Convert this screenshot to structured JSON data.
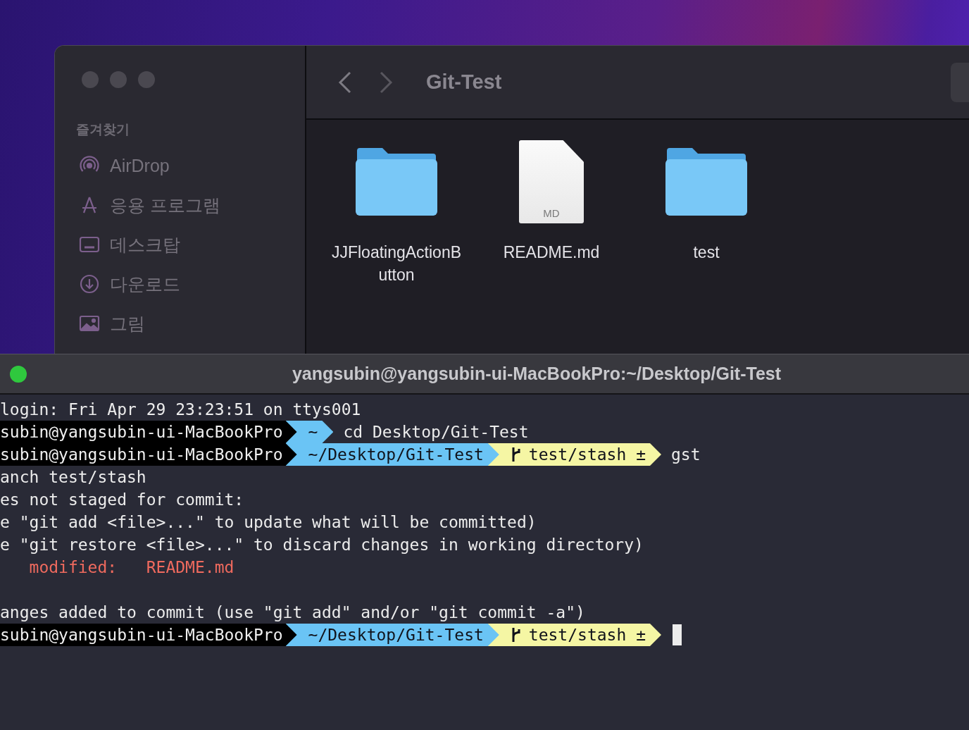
{
  "finder": {
    "title": "Git-Test",
    "sidebar": {
      "heading": "즐겨찾기",
      "items": [
        {
          "kind": "airdrop",
          "label": "AirDrop"
        },
        {
          "kind": "apps",
          "label": "응용 프로그램"
        },
        {
          "kind": "desktop",
          "label": "데스크탑"
        },
        {
          "kind": "downloads",
          "label": "다운로드"
        },
        {
          "kind": "pictures",
          "label": "그림"
        }
      ]
    },
    "files": [
      {
        "kind": "folder",
        "name": "JJFloatingActionButton"
      },
      {
        "kind": "document",
        "name": "README.md",
        "badge": "MD"
      },
      {
        "kind": "folder",
        "name": "test"
      }
    ]
  },
  "terminal": {
    "title": "yangsubin@yangsubin-ui-MacBookPro:~/Desktop/Git-Test",
    "lines": [
      {
        "kind": "text",
        "text": "login: Fri Apr 29 23:23:51 on ttys001"
      },
      {
        "kind": "prompt",
        "segments": [
          {
            "kind": "user",
            "text": "subin@yangsubin-ui-MacBookPro"
          },
          {
            "kind": "dir",
            "text": "~"
          }
        ],
        "command": "cd Desktop/Git-Test",
        "cursor": false
      },
      {
        "kind": "prompt",
        "segments": [
          {
            "kind": "user",
            "text": "subin@yangsubin-ui-MacBookPro"
          },
          {
            "kind": "dir",
            "text": "~/Desktop/Git-Test"
          },
          {
            "kind": "git",
            "text": "test/stash ±"
          }
        ],
        "command": "gst",
        "cursor": false
      },
      {
        "kind": "text",
        "text": "anch test/stash"
      },
      {
        "kind": "text",
        "text": "es not staged for commit:"
      },
      {
        "kind": "text",
        "text": "e \"git add <file>...\" to update what will be committed)"
      },
      {
        "kind": "text",
        "text": "e \"git restore <file>...\" to discard changes in working directory)"
      },
      {
        "kind": "changed",
        "label": "modified:",
        "file": "README.md"
      },
      {
        "kind": "blank"
      },
      {
        "kind": "text",
        "text": "anges added to commit (use \"git add\" and/or \"git commit -a\")"
      },
      {
        "kind": "prompt",
        "segments": [
          {
            "kind": "user",
            "text": "subin@yangsubin-ui-MacBookPro"
          },
          {
            "kind": "dir",
            "text": "~/Desktop/Git-Test"
          },
          {
            "kind": "git",
            "text": "test/stash ±"
          }
        ],
        "cursor": true
      }
    ]
  }
}
